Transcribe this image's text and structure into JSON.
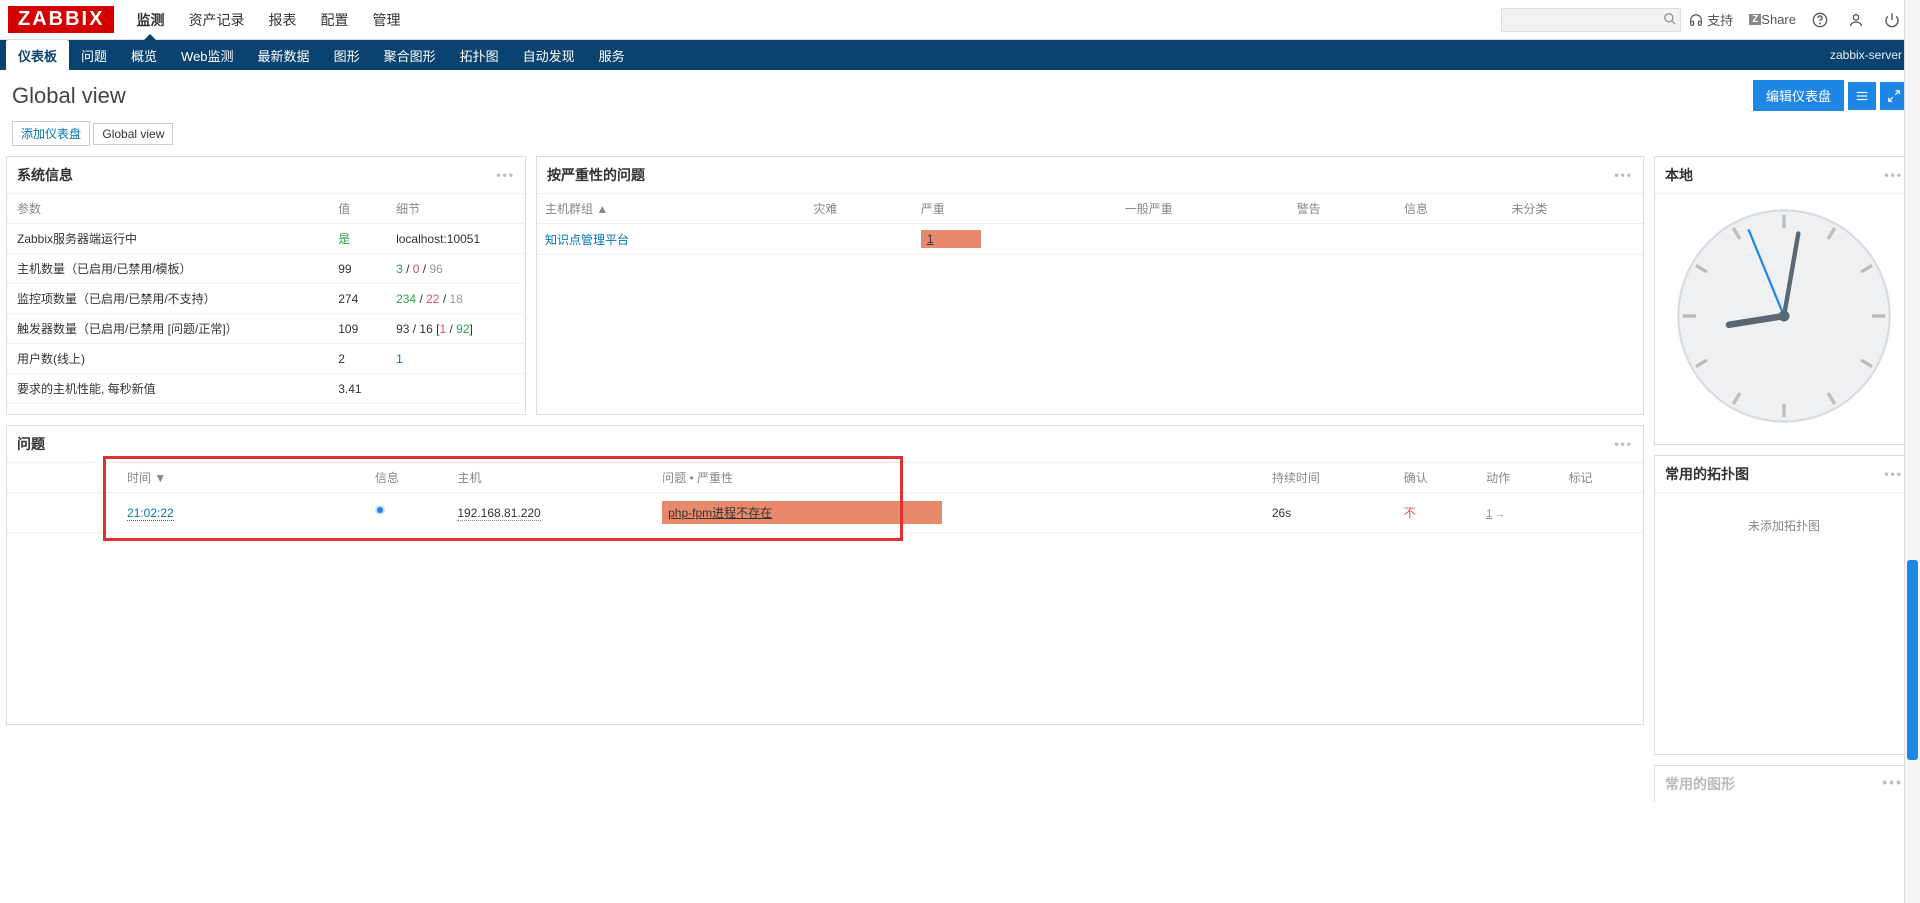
{
  "brand": "ZABBIX",
  "topnav": {
    "items": [
      "监测",
      "资产记录",
      "报表",
      "配置",
      "管理"
    ],
    "active": 0,
    "support": "支持",
    "share": "Share",
    "search_placeholder": ""
  },
  "subnav": {
    "items": [
      "仪表板",
      "问题",
      "概览",
      "Web监测",
      "最新数据",
      "图形",
      "聚合图形",
      "拓扑图",
      "自动发现",
      "服务"
    ],
    "active": 0,
    "server": "zabbix-server"
  },
  "page": {
    "title": "Global view",
    "edit_btn": "编辑仪表盘"
  },
  "breadcrumb": {
    "home": "添加仪表盘",
    "sep": "/",
    "current": "Global view"
  },
  "widgets": {
    "sysinfo": {
      "title": "系统信息",
      "headers": {
        "param": "参数",
        "value": "值",
        "detail": "细节"
      },
      "rows": [
        {
          "param": "Zabbix服务器端运行中",
          "value": "是",
          "value_class": "green",
          "detail": "localhost:10051"
        },
        {
          "param": "主机数量（已启用/已禁用/模板）",
          "value": "99",
          "detail_parts": [
            [
              "3",
              "green"
            ],
            [
              " / ",
              ""
            ],
            [
              "0",
              "red"
            ],
            [
              " / ",
              ""
            ],
            [
              "96",
              "gray"
            ]
          ]
        },
        {
          "param": "监控项数量（已启用/已禁用/不支持）",
          "value": "274",
          "detail_parts": [
            [
              "234",
              "green"
            ],
            [
              " / ",
              ""
            ],
            [
              "22",
              "red"
            ],
            [
              " / ",
              ""
            ],
            [
              "18",
              "gray"
            ]
          ]
        },
        {
          "param": "触发器数量（已启用/已禁用 [问题/正常]）",
          "value": "109",
          "detail_parts": [
            [
              "93 / 16 [",
              ""
            ],
            [
              "1",
              "red"
            ],
            [
              " / ",
              ""
            ],
            [
              "92",
              "green"
            ],
            [
              "]",
              ""
            ]
          ]
        },
        {
          "param": "用户数(线上)",
          "value": "2",
          "detail_parts": [
            [
              "1",
              "blue"
            ]
          ]
        },
        {
          "param": "要求的主机性能, 每秒新值",
          "value": "3.41",
          "detail": ""
        }
      ]
    },
    "severity": {
      "title": "按严重性的问题",
      "headers": [
        "主机群组 ▲",
        "灾难",
        "严重",
        "一般严重",
        "警告",
        "信息",
        "未分类"
      ],
      "rows": [
        {
          "group": "知识点管理平台",
          "severe": "1"
        }
      ]
    },
    "clock": {
      "title": "本地"
    },
    "problems": {
      "title": "问题",
      "headers": [
        "时间 ▼",
        "信息",
        "主机",
        "问题 • 严重性",
        "持续时间",
        "确认",
        "动作",
        "标记"
      ],
      "rows": [
        {
          "time": "21:02:22",
          "host": "192.168.81.220",
          "problem": "php-fpm进程不存在",
          "duration": "26s",
          "ack": "不",
          "action": "1"
        }
      ]
    },
    "topology": {
      "title": "常用的拓扑图",
      "empty": "未添加拓扑图"
    },
    "graphs_stub": {
      "title": "常用的图形"
    }
  }
}
